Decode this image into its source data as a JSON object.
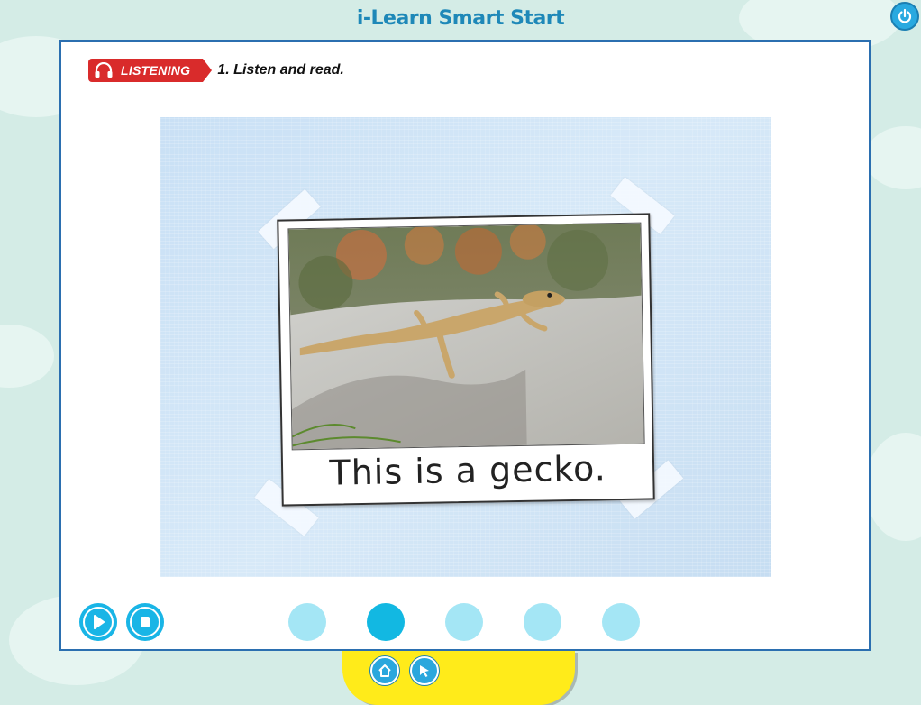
{
  "app": {
    "title": "i-Learn Smart Start"
  },
  "header": {
    "power_icon": "power-icon"
  },
  "instruction": {
    "badge_label": "LISTENING",
    "badge_icon": "headphones-icon",
    "text": "1. Listen and read.",
    "badge_color": "#d92b2b"
  },
  "scene": {
    "caption": "This is a gecko.",
    "image": "gecko-photo"
  },
  "playback": {
    "play_icon": "play-icon",
    "stop_icon": "stop-icon",
    "accent": "#19b5e6"
  },
  "pagination": {
    "total": 5,
    "active_index": 2
  },
  "bottom_nav": {
    "home_icon": "home-icon",
    "pointer_icon": "pointer-icon",
    "tray_color": "#ffeb1a"
  }
}
